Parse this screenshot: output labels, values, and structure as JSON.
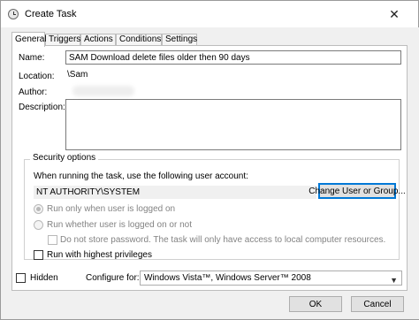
{
  "window": {
    "title": "Create Task",
    "close_glyph": "✕"
  },
  "tabs": [
    {
      "label": "General",
      "active": true
    },
    {
      "label": "Triggers"
    },
    {
      "label": "Actions"
    },
    {
      "label": "Conditions"
    },
    {
      "label": "Settings"
    }
  ],
  "general": {
    "name_label": "Name:",
    "name_value": "SAM Download delete files older then 90 days",
    "location_label": "Location:",
    "location_value": "\\Sam",
    "author_label": "Author:",
    "description_label": "Description:",
    "description_value": ""
  },
  "security": {
    "legend": "Security options",
    "account_prompt": "When running the task, use the following user account:",
    "account_value": "NT AUTHORITY\\SYSTEM",
    "change_button": "Change User or Group...",
    "radio_logged_on": "Run only when user is logged on",
    "radio_whether": "Run whether user is logged on or not",
    "no_store_password": "Do not store password.  The task will only have access to local computer resources.",
    "highest_privileges": "Run with highest privileges"
  },
  "bottom": {
    "hidden_label": "Hidden",
    "configure_label": "Configure for:",
    "configure_value": "Windows Vista™, Windows Server™ 2008",
    "ok_button": "OK",
    "cancel_button": "Cancel"
  },
  "colors": {
    "focus_accent": "#0078d7",
    "window_bg": "#f0f0f0",
    "disabled_text": "#838383"
  },
  "icons": {
    "title": "task-clock-icon",
    "close": "close-icon",
    "dropdown": "chevron-down-icon"
  }
}
